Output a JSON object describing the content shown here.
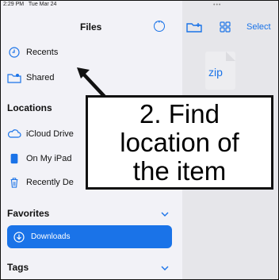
{
  "status": {
    "time": "2:29 PM",
    "date": "Tue Mar 24"
  },
  "header": {
    "title": "Files",
    "select_label": "Select"
  },
  "sidebar": {
    "items": [
      {
        "label": "Recents",
        "icon": "clock-icon"
      },
      {
        "label": "Shared",
        "icon": "shared-folder-icon"
      }
    ],
    "locations": {
      "title": "Locations",
      "items": [
        {
          "label": "iCloud Drive",
          "icon": "cloud-icon"
        },
        {
          "label": "On My iPad",
          "icon": "ipad-icon"
        },
        {
          "label": "Recently De",
          "icon": "trash-icon"
        }
      ]
    },
    "favorites": {
      "title": "Favorites",
      "items": [
        {
          "label": "Downloads",
          "icon": "download-circle-icon",
          "selected": true
        }
      ]
    },
    "tags": {
      "title": "Tags"
    }
  },
  "content": {
    "file": {
      "label": "zip"
    }
  },
  "callout": {
    "lines": [
      "2. Find",
      "location of",
      "the item"
    ]
  },
  "colors": {
    "accent": "#1a73e8",
    "sidebar_bg": "#f2f2f7",
    "content_bg": "#e6e6ea"
  }
}
